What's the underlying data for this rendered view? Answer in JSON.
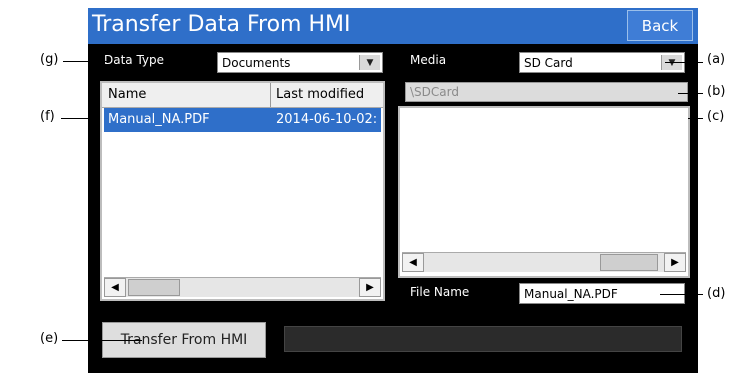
{
  "window": {
    "title": "Transfer Data From HMI",
    "back_label": "Back"
  },
  "data_type": {
    "label": "Data Type",
    "value": "Documents"
  },
  "file_list": {
    "columns": [
      "Name",
      "Last modified"
    ],
    "rows": [
      {
        "name": "Manual_NA.PDF",
        "modified": "2014-06-10-02:"
      }
    ]
  },
  "media": {
    "label": "Media",
    "value": "SD Card",
    "path": "\\SDCard"
  },
  "file_name": {
    "label": "File Name",
    "value": "Manual_NA.PDF"
  },
  "transfer": {
    "label": "Transfer From HMI"
  },
  "callouts": {
    "a": "(a)",
    "b": "(b)",
    "c": "(c)",
    "d": "(d)",
    "e": "(e)",
    "f": "(f)",
    "g": "(g)"
  },
  "colors": {
    "header": "#2f6fc9",
    "selection": "#2f6fc9",
    "panel": "#000000"
  }
}
